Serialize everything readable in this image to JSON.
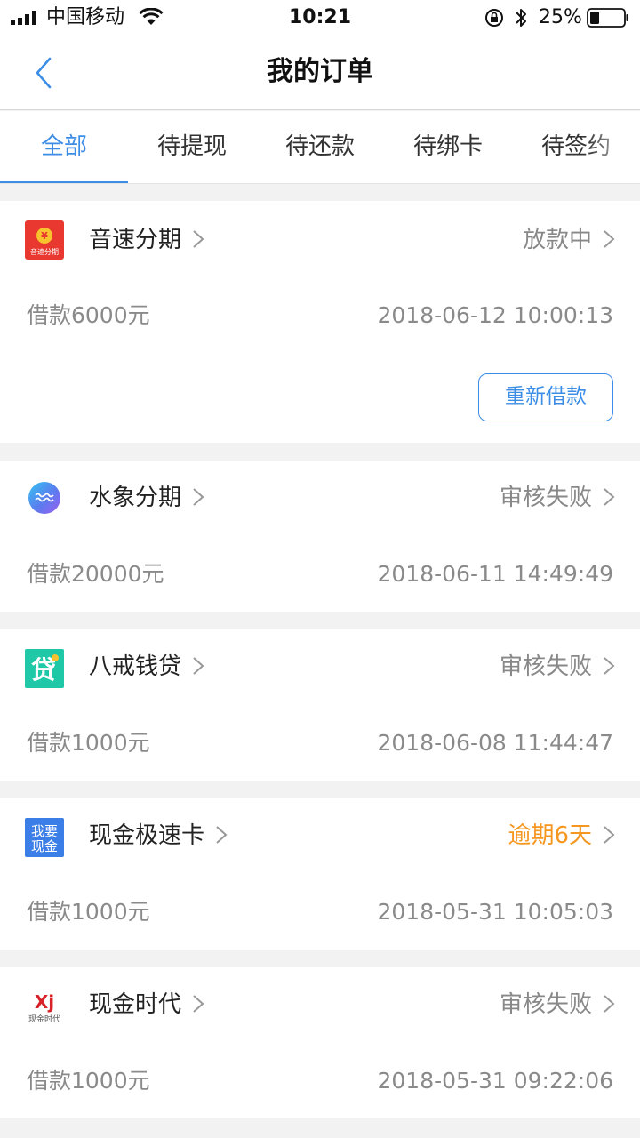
{
  "status_bar": {
    "carrier": "中国移动",
    "time": "10:21",
    "battery_pct": "25%"
  },
  "nav": {
    "title": "我的订单",
    "back_icon": "chevron-left-icon"
  },
  "colors": {
    "accent": "#3c8de6",
    "warn": "#f5961e",
    "muted": "#8a8a8a"
  },
  "tabs": [
    {
      "label": "全部",
      "active": true
    },
    {
      "label": "待提现",
      "active": false
    },
    {
      "label": "待还款",
      "active": false
    },
    {
      "label": "待绑卡",
      "active": false
    },
    {
      "label": "待签约",
      "active": false
    }
  ],
  "orders": [
    {
      "name": "音速分期",
      "logo_text": "音速分期",
      "logo_icon": "yinsu-logo-icon",
      "status": "放款中",
      "amount": "借款6000元",
      "datetime": "2018-06-12 10:00:13",
      "action": "重新借款"
    },
    {
      "name": "水象分期",
      "logo_icon": "shuixiang-logo-icon",
      "status": "审核失败",
      "amount": "借款20000元",
      "datetime": "2018-06-11 14:49:49"
    },
    {
      "name": "八戒钱贷",
      "logo_text": "贷",
      "logo_icon": "bajie-logo-icon",
      "status": "审核失败",
      "amount": "借款1000元",
      "datetime": "2018-06-08 11:44:47"
    },
    {
      "name": "现金极速卡",
      "logo_text_top": "我要",
      "logo_text_bottom": "现金",
      "logo_icon": "woyaoxianjin-logo-icon",
      "status": "逾期6天",
      "amount": "借款1000元",
      "datetime": "2018-05-31 10:05:03"
    },
    {
      "name": "现金时代",
      "logo_text_top": "Xj",
      "logo_text_bottom": "现金时代",
      "logo_icon": "xianjinshidai-logo-icon",
      "status": "审核失败",
      "amount": "借款1000元",
      "datetime": "2018-05-31 09:22:06"
    }
  ]
}
